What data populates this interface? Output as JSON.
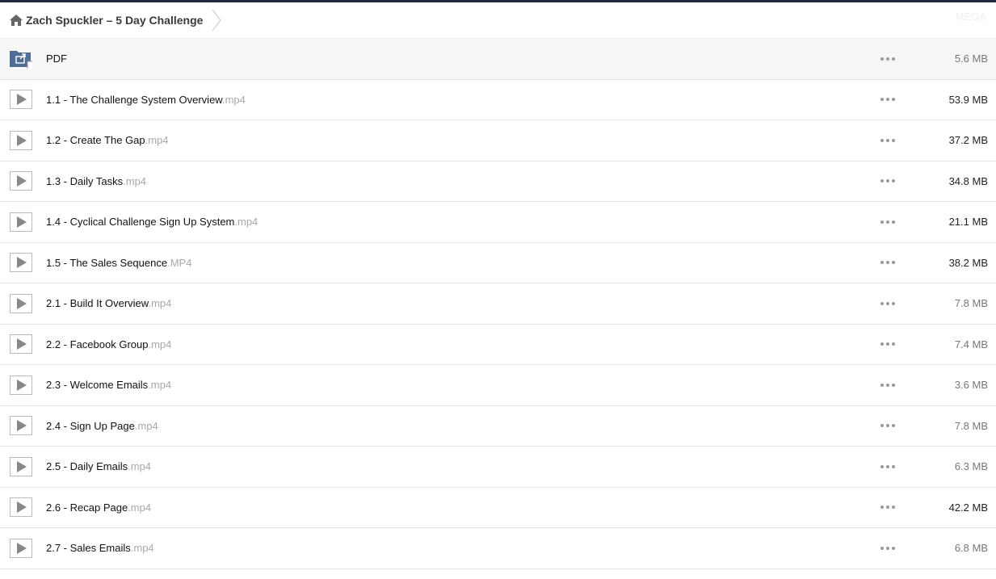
{
  "breadcrumb": {
    "title": "Zach Spuckler – 5 Day Challenge",
    "right_faint": "MEGA"
  },
  "colors": {
    "topbar": "#1f2a3a",
    "folder_icon": "#4f6d94",
    "play_icon": "#888888",
    "ext_text": "#a8a8a8"
  },
  "items": [
    {
      "name": "PDF",
      "ext": "",
      "size": "5.6 MB",
      "type": "folder-link",
      "icon": "folder-link-icon",
      "size_tone": "light"
    },
    {
      "name": "1.1 - The Challenge System Overview",
      "ext": ".mp4",
      "size": "53.9 MB",
      "type": "video",
      "icon": "play-icon",
      "size_tone": "dark"
    },
    {
      "name": "1.2 - Create The Gap",
      "ext": ".mp4",
      "size": "37.2 MB",
      "type": "video",
      "icon": "play-icon",
      "size_tone": "dark"
    },
    {
      "name": "1.3 - Daily Tasks",
      "ext": ".mp4",
      "size": "34.8 MB",
      "type": "video",
      "icon": "play-icon",
      "size_tone": "dark"
    },
    {
      "name": "1.4 - Cyclical Challenge Sign Up System",
      "ext": ".mp4",
      "size": "21.1 MB",
      "type": "video",
      "icon": "play-icon",
      "size_tone": "dark"
    },
    {
      "name": "1.5 - The Sales Sequence",
      "ext": ".MP4",
      "size": "38.2 MB",
      "type": "video",
      "icon": "play-icon",
      "size_tone": "dark"
    },
    {
      "name": "2.1 - Build It Overview",
      "ext": ".mp4",
      "size": "7.8 MB",
      "type": "video",
      "icon": "play-icon",
      "size_tone": "light"
    },
    {
      "name": "2.2 - Facebook Group",
      "ext": ".mp4",
      "size": "7.4 MB",
      "type": "video",
      "icon": "play-icon",
      "size_tone": "light"
    },
    {
      "name": "2.3 - Welcome Emails",
      "ext": ".mp4",
      "size": "3.6 MB",
      "type": "video",
      "icon": "play-icon",
      "size_tone": "light"
    },
    {
      "name": "2.4 - Sign Up Page",
      "ext": ".mp4",
      "size": "7.8 MB",
      "type": "video",
      "icon": "play-icon",
      "size_tone": "light"
    },
    {
      "name": "2.5 - Daily Emails",
      "ext": ".mp4",
      "size": "6.3 MB",
      "type": "video",
      "icon": "play-icon",
      "size_tone": "light"
    },
    {
      "name": "2.6 - Recap Page",
      "ext": ".mp4",
      "size": "42.2 MB",
      "type": "video",
      "icon": "play-icon",
      "size_tone": "dark"
    },
    {
      "name": "2.7 - Sales Emails",
      "ext": ".mp4",
      "size": "6.8 MB",
      "type": "video",
      "icon": "play-icon",
      "size_tone": "light"
    }
  ]
}
